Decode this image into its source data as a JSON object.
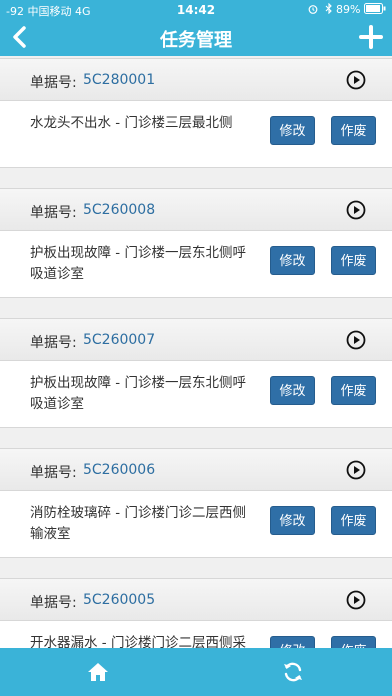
{
  "status": {
    "carrier": "-92 中国移动  4G",
    "time": "14:42",
    "battery": "89%"
  },
  "nav": {
    "title": "任务管理"
  },
  "orderLabel": "单据号:",
  "buttons": {
    "edit": "修改",
    "void": "作废"
  },
  "tasks": [
    {
      "orderNo": "5C280001",
      "description": "水龙头不出水 - 门诊楼三层最北侧"
    },
    {
      "orderNo": "5C260008",
      "description": "护板出现故障 - 门诊楼一层东北侧呼吸道诊室"
    },
    {
      "orderNo": "5C260007",
      "description": "护板出现故障 - 门诊楼一层东北侧呼吸道诊室"
    },
    {
      "orderNo": "5C260006",
      "description": "消防栓玻璃碎 - 门诊楼门诊二层西侧输液室"
    },
    {
      "orderNo": "5C260005",
      "description": "开水器漏水 - 门诊楼门诊二层西侧采血室"
    }
  ],
  "icons": {
    "back": "chevron-left-icon",
    "add": "plus-icon",
    "play": "play-circle-icon",
    "home": "home-icon",
    "refresh": "refresh-icon"
  }
}
